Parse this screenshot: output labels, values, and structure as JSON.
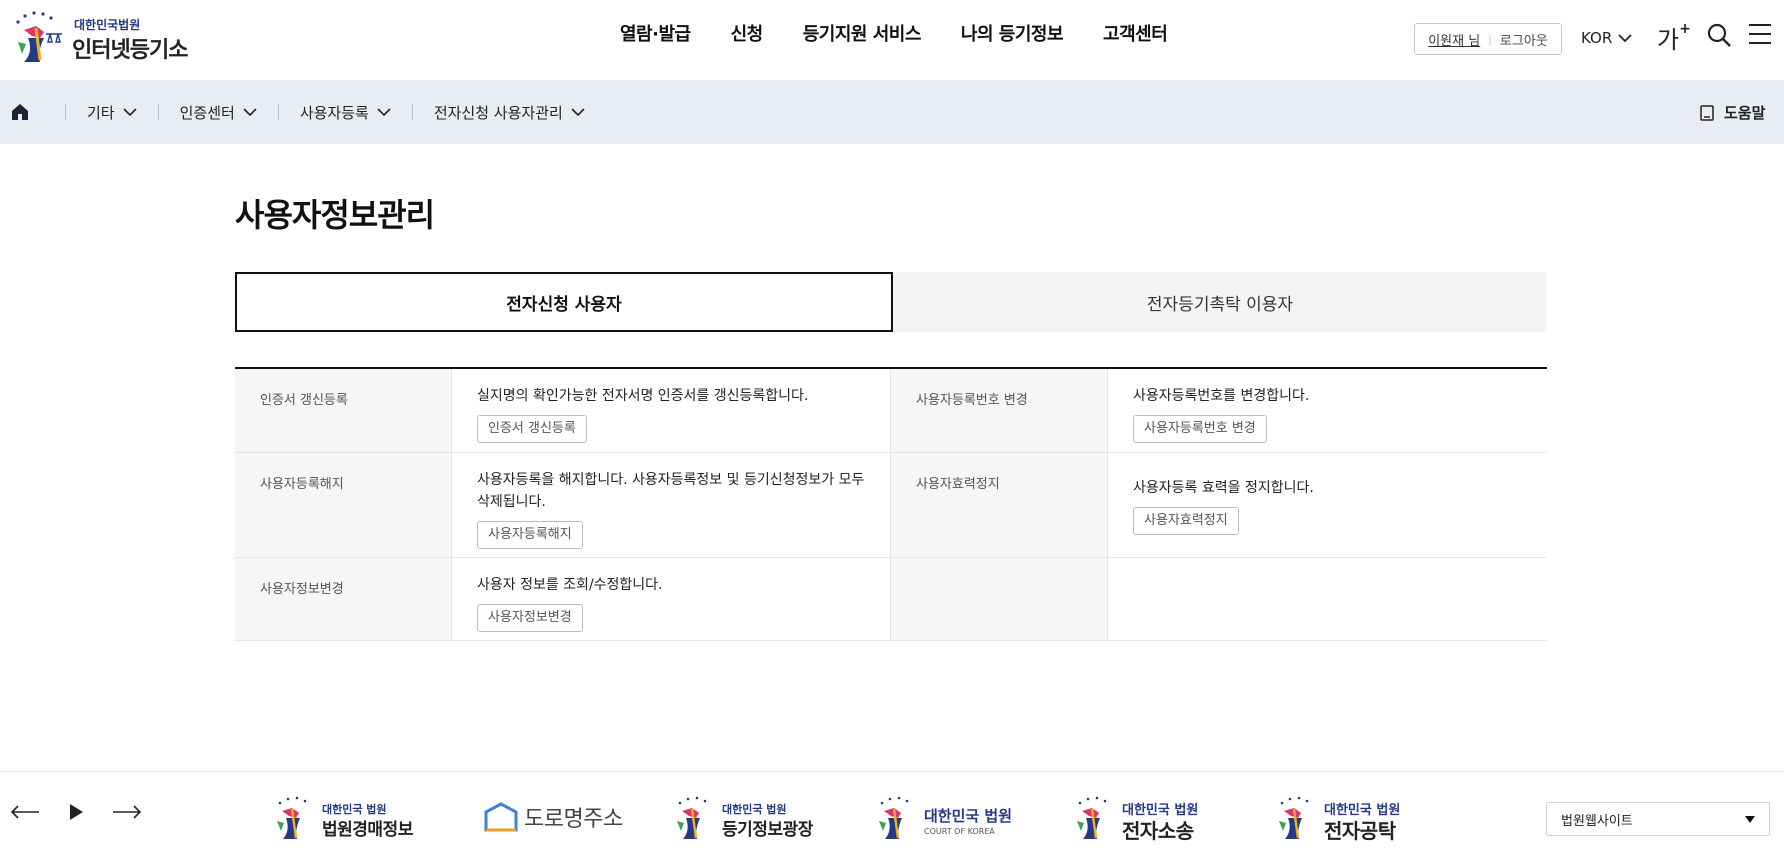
{
  "header": {
    "logo_small": "대한민국법원",
    "logo_big": "인터넷등기소",
    "gnb": [
      "열람·발급",
      "신청",
      "등기지원 서비스",
      "나의 등기정보",
      "고객센터"
    ],
    "user_name": "이원재 님",
    "logout_label": "로그아웃",
    "lang": "KOR",
    "font_size_label": "가",
    "font_size_plus": "+"
  },
  "breadcrumb": {
    "items": [
      "기타",
      "인증센터",
      "사용자등록",
      "전자신청 사용자관리"
    ],
    "help_label": "도움말"
  },
  "main": {
    "title": "사용자정보관리",
    "tabs": [
      {
        "label": "전자신청 사용자",
        "active": true
      },
      {
        "label": "전자등기촉탁 이용자",
        "active": false
      }
    ],
    "rows": [
      {
        "left": {
          "label": "인증서 갱신등록",
          "desc": "실지명의 확인가능한 전자서명 인증서를 갱신등록합니다.",
          "button": "인증서 갱신등록"
        },
        "right": {
          "label": "사용자등록번호 변경",
          "desc": "사용자등록번호를 변경합니다.",
          "button": "사용자등록번호 변경"
        }
      },
      {
        "left": {
          "label": "사용자등록해지",
          "desc": "사용자등록을 해지합니다. 사용자등록정보 및 등기신청정보가 모두 삭제됩니다.",
          "button": "사용자등록해지"
        },
        "right": {
          "label": "사용자효력정지",
          "desc": "사용자등록 효력을 정지합니다.",
          "button": "사용자효력정지"
        }
      },
      {
        "left": {
          "label": "사용자정보변경",
          "desc": "사용자 정보를 조회/수정합니다.",
          "button": "사용자정보변경"
        },
        "right": {
          "label": "",
          "desc": "",
          "button": ""
        }
      }
    ]
  },
  "footer": {
    "sites": [
      {
        "small": "대한민국 법원",
        "big": "법원경매정보"
      },
      {
        "big": "도로명주소"
      },
      {
        "small": "대한민국 법원",
        "big": "등기정보광장"
      },
      {
        "small": "대한민국 법원",
        "eng": "COURT OF KOREA"
      },
      {
        "small": "대한민국 법원",
        "big": "전자소송"
      },
      {
        "small": "대한민국 법원",
        "big": "전자공탁"
      }
    ],
    "select_label": "법원웹사이트"
  },
  "colors": {
    "court_blue": "#233a86",
    "bc_bg": "#e9edf3",
    "road_blue": "#3d7fd9",
    "road_orange": "#f29b22"
  }
}
